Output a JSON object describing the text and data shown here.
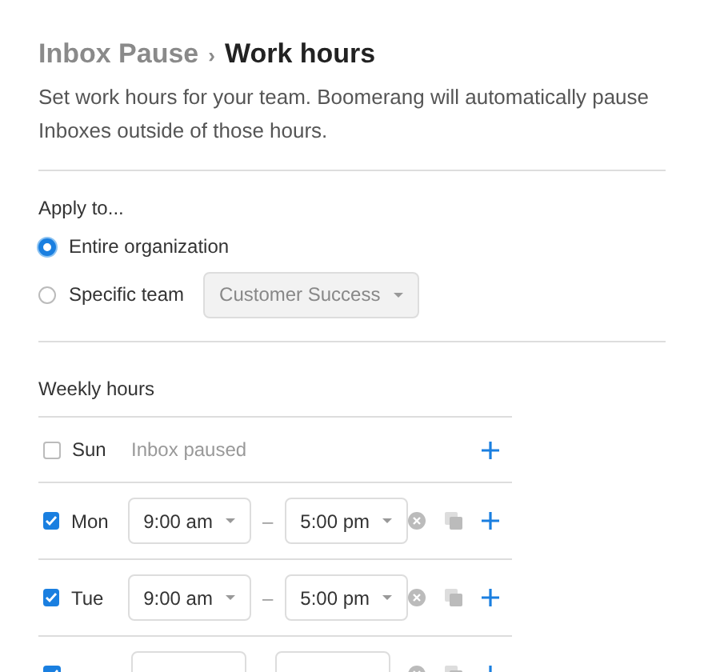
{
  "breadcrumb": {
    "parent": "Inbox Pause",
    "separator": "›",
    "current": "Work hours"
  },
  "description": "Set work hours for your team. Boomerang will automatically pause Inboxes outside of those hours.",
  "apply_to": {
    "label": "Apply to...",
    "options": [
      {
        "label": "Entire organization",
        "selected": true
      },
      {
        "label": "Specific team",
        "selected": false,
        "team_select": {
          "value": "Customer Success",
          "disabled": true
        }
      }
    ]
  },
  "weekly_hours": {
    "label": "Weekly hours",
    "days": [
      {
        "day": "Sun",
        "checked": false,
        "paused_text": "Inbox paused"
      },
      {
        "day": "Mon",
        "checked": true,
        "start": "9:00 am",
        "end": "5:00 pm",
        "separator": "–"
      },
      {
        "day": "Tue",
        "checked": true,
        "start": "9:00 am",
        "end": "5:00 pm",
        "separator": "–"
      },
      {
        "checked": true
      }
    ]
  }
}
